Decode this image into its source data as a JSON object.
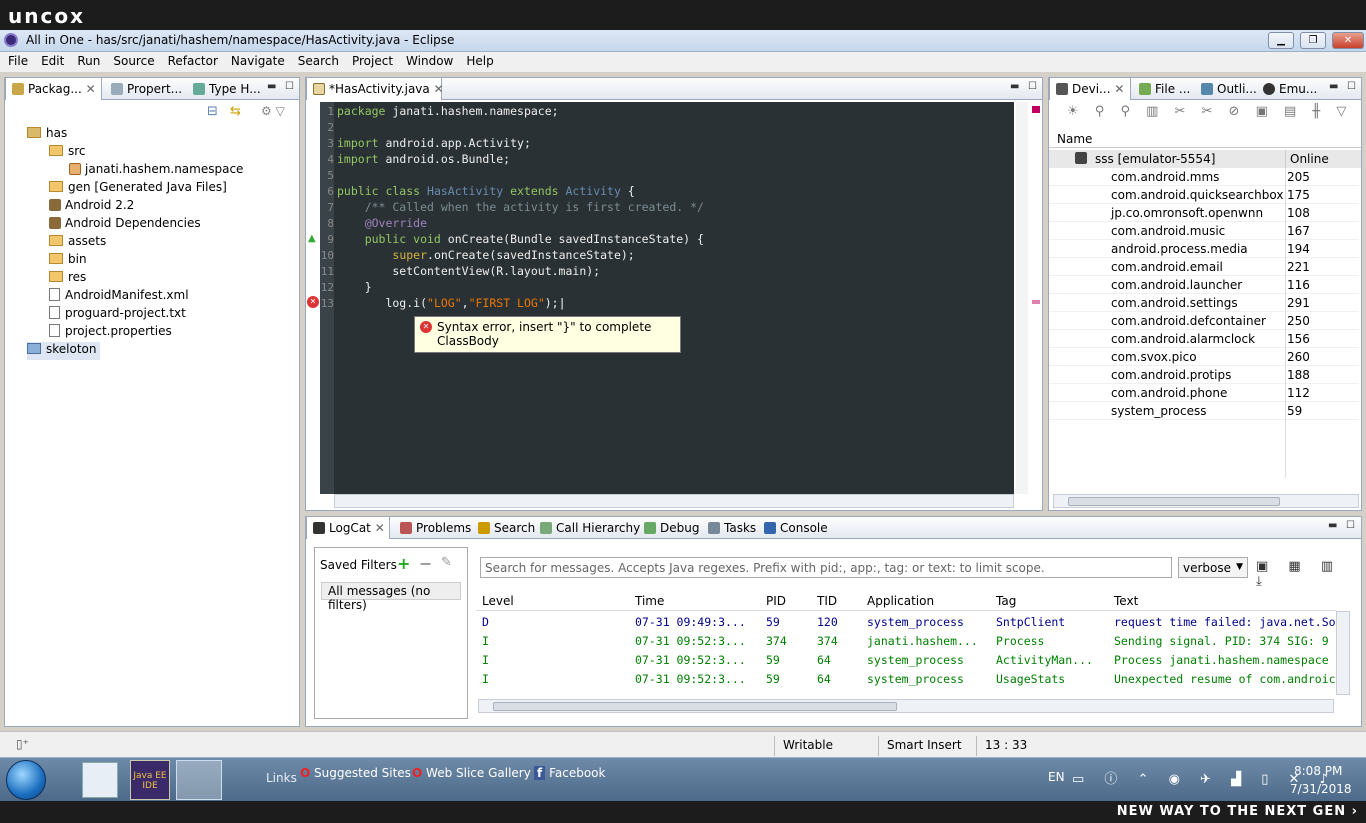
{
  "brand": {
    "logo": "uncox",
    "tagline": "NEW WAY TO THE NEXT GEN ›"
  },
  "window": {
    "title": "All in One - has/src/janati/hashem/namespace/HasActivity.java - Eclipse"
  },
  "menu": [
    "File",
    "Edit",
    "Run",
    "Source",
    "Refactor",
    "Navigate",
    "Search",
    "Project",
    "Window",
    "Help"
  ],
  "left_panel": {
    "tabs": [
      "Packag...",
      "Propert...",
      "Type H..."
    ],
    "tree": [
      {
        "label": "has",
        "level": 0,
        "kind": "project"
      },
      {
        "label": "src",
        "level": 1,
        "kind": "folder"
      },
      {
        "label": "janati.hashem.namespace",
        "level": 2,
        "kind": "package"
      },
      {
        "label": "gen [Generated Java Files]",
        "level": 1,
        "kind": "folder"
      },
      {
        "label": "Android 2.2",
        "level": 1,
        "kind": "lib"
      },
      {
        "label": "Android Dependencies",
        "level": 1,
        "kind": "lib"
      },
      {
        "label": "assets",
        "level": 1,
        "kind": "folder"
      },
      {
        "label": "bin",
        "level": 1,
        "kind": "folder"
      },
      {
        "label": "res",
        "level": 1,
        "kind": "folder"
      },
      {
        "label": "AndroidManifest.xml",
        "level": 1,
        "kind": "file"
      },
      {
        "label": "proguard-project.txt",
        "level": 1,
        "kind": "file"
      },
      {
        "label": "project.properties",
        "level": 1,
        "kind": "file"
      },
      {
        "label": "skeloton",
        "level": 0,
        "kind": "project"
      }
    ]
  },
  "editor": {
    "tab": "*HasActivity.java",
    "line_numbers": [
      "1",
      "2",
      "3",
      "4",
      "5",
      "6",
      "7",
      "8",
      "9",
      "10",
      "11",
      "12",
      "13"
    ],
    "code": {
      "l1_kw": "package",
      "l1_rest": " janati.hashem.namespace;",
      "l3_kw": "import",
      "l3_rest": " android.app.Activity;",
      "l4_kw": "import",
      "l4_rest": " android.os.Bundle;",
      "l6_a": "public class",
      "l6_b": " HasActivity ",
      "l6_c": "extends",
      "l6_d": " Activity",
      "l6_e": " {",
      "l7": "    /** Called when the activity is first created. */",
      "l8_a": "    ",
      "l8_b": "@Override",
      "l9_a": "    public void",
      "l9_b": " onCreate(Bundle savedInstanceState) {",
      "l10_a": "        ",
      "l10_b": "super",
      "l10_c": ".onCreate(savedInstanceState);",
      "l11": "        setContentView(R.layout.main);",
      "l12": "    }",
      "l13_a": "       log.i(",
      "l13_b": "\"LOG\"",
      "l13_c": ",",
      "l13_d": "\"FIRST LOG\"",
      "l13_e": ");"
    },
    "error_tooltip": "Syntax error, insert \"}\" to complete ClassBody"
  },
  "right_panel": {
    "tabs": [
      "Devi...",
      "File ...",
      "Outli...",
      "Emu..."
    ],
    "col_name": "Name",
    "device": {
      "name": "sss [emulator-5554]",
      "status": "Online"
    },
    "processes": [
      {
        "name": "com.android.mms",
        "pid": "205"
      },
      {
        "name": "com.android.quicksearchbox",
        "pid": "175"
      },
      {
        "name": "jp.co.omronsoft.openwnn",
        "pid": "108"
      },
      {
        "name": "com.android.music",
        "pid": "167"
      },
      {
        "name": "android.process.media",
        "pid": "194"
      },
      {
        "name": "com.android.email",
        "pid": "221"
      },
      {
        "name": "com.android.launcher",
        "pid": "116"
      },
      {
        "name": "com.android.settings",
        "pid": "291"
      },
      {
        "name": "com.android.defcontainer",
        "pid": "250"
      },
      {
        "name": "com.android.alarmclock",
        "pid": "156"
      },
      {
        "name": "com.svox.pico",
        "pid": "260"
      },
      {
        "name": "com.android.protips",
        "pid": "188"
      },
      {
        "name": "com.android.phone",
        "pid": "112"
      },
      {
        "name": "system_process",
        "pid": "59"
      }
    ]
  },
  "bottom_panel": {
    "tabs": [
      "LogCat",
      "Problems",
      "Search",
      "Call Hierarchy",
      "Debug",
      "Tasks",
      "Console"
    ],
    "saved_filters": "Saved Filters",
    "all_messages": "All messages (no filters)",
    "search_placeholder": "Search for messages. Accepts Java regexes. Prefix with pid:, app:, tag: or text: to limit scope.",
    "level_select": "verbose",
    "columns": [
      "Level",
      "Time",
      "PID",
      "TID",
      "Application",
      "Tag",
      "Text"
    ],
    "rows": [
      {
        "level": "D",
        "time": "07-31 09:49:3...",
        "pid": "59",
        "tid": "120",
        "app": "system_process",
        "tag": "SntpClient",
        "text": "request time failed: java.net.So",
        "color": "#00008b"
      },
      {
        "level": "I",
        "time": "07-31 09:52:3...",
        "pid": "374",
        "tid": "374",
        "app": "janati.hashem...",
        "tag": "Process",
        "text": "Sending signal. PID: 374 SIG: 9",
        "color": "#008000"
      },
      {
        "level": "I",
        "time": "07-31 09:52:3...",
        "pid": "59",
        "tid": "64",
        "app": "system_process",
        "tag": "ActivityMan...",
        "text": "Process janati.hashem.namespace",
        "color": "#008000"
      },
      {
        "level": "I",
        "time": "07-31 09:52:3...",
        "pid": "59",
        "tid": "64",
        "app": "system_process",
        "tag": "UsageStats",
        "text": "Unexpected resume of com.androic",
        "color": "#008000"
      }
    ]
  },
  "status": {
    "writable": "Writable",
    "insert": "Smart Insert",
    "position": "13 : 33"
  },
  "taskbar": {
    "links_label": "Links",
    "links": [
      "Suggested Sites",
      "Web Slice Gallery",
      "Facebook"
    ],
    "lang": "EN",
    "time": "8:08 PM",
    "date": "7/31/2018",
    "eclipse_label": "Java EE IDE"
  }
}
